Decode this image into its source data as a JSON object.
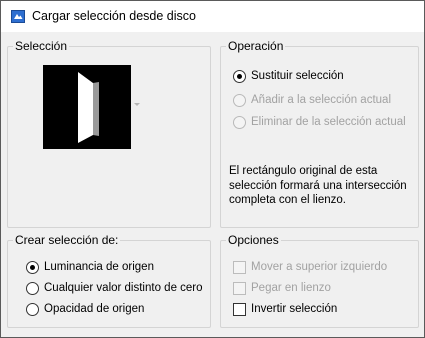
{
  "window": {
    "title": "Cargar selección desde disco"
  },
  "seleccion": {
    "label": "Selección"
  },
  "operacion": {
    "label": "Operación",
    "options": [
      {
        "label": "Sustituir selección",
        "checked": true,
        "enabled": true
      },
      {
        "label": "Añadir a la selección actual",
        "checked": false,
        "enabled": false
      },
      {
        "label": "Eliminar de la selección actual",
        "checked": false,
        "enabled": false
      }
    ],
    "info": "El rectángulo original de esta selección formará una intersección completa con el lienzo."
  },
  "crear": {
    "label": "Crear selección de:",
    "options": [
      {
        "label": "Luminancia de origen",
        "checked": true
      },
      {
        "label": "Cualquier valor distinto de cero",
        "checked": false
      },
      {
        "label": "Opacidad de origen",
        "checked": false
      }
    ]
  },
  "opciones": {
    "label": "Opciones",
    "items": [
      {
        "label": "Mover a superior izquierdo",
        "checked": false,
        "enabled": false
      },
      {
        "label": "Pegar en lienzo",
        "checked": false,
        "enabled": false
      },
      {
        "label": "Invertir selección",
        "checked": false,
        "enabled": true
      }
    ]
  }
}
